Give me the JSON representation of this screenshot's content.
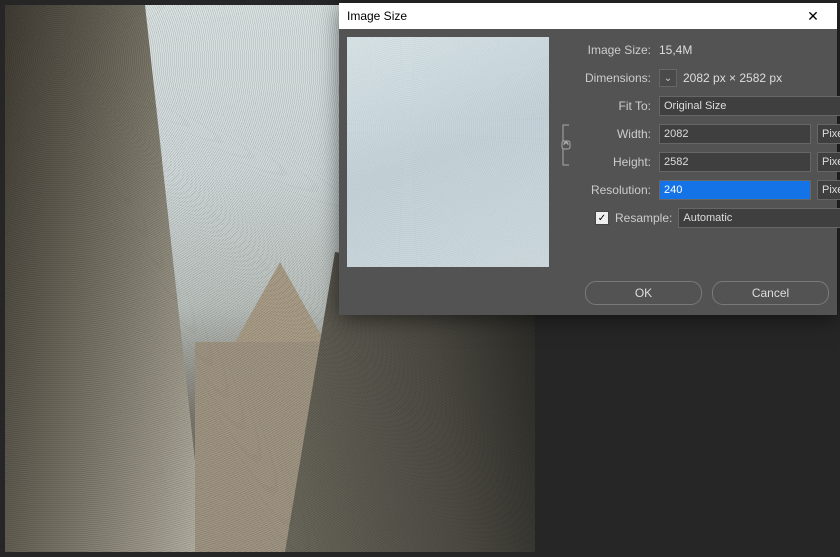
{
  "dialog": {
    "title": "Image Size",
    "image_size_label": "Image Size:",
    "image_size_value": "15,4M",
    "dimensions_label": "Dimensions:",
    "dimensions_value": "2082 px × 2582 px",
    "fit_to_label": "Fit To:",
    "fit_to_value": "Original Size",
    "width_label": "Width:",
    "width_value": "2082",
    "width_unit": "Pixels",
    "height_label": "Height:",
    "height_value": "2582",
    "height_unit": "Pixels",
    "resolution_label": "Resolution:",
    "resolution_value": "240",
    "resolution_unit": "Pixels/Inch",
    "resample_label": "Resample:",
    "resample_checked": "✓",
    "resample_value": "Automatic",
    "ok_label": "OK",
    "cancel_label": "Cancel",
    "dim_toggle_glyph": "⌄",
    "chevron": "⌄"
  }
}
